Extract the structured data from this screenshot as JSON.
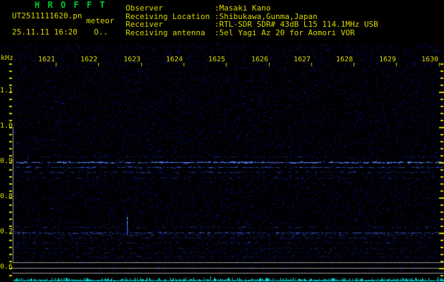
{
  "header": {
    "title": "H R O F F T",
    "filename": "UT2511111620.pn",
    "observation_label": "meteor",
    "datetime": "25.11.11 16:20",
    "counter": "O..",
    "info": [
      {
        "label": "Observer",
        "value": ":Masaki Kano"
      },
      {
        "label": "Receiving Location",
        "value": ":Shibukawa,Gunma,Japan"
      },
      {
        "label": "Receiver",
        "value": ":RTL-SDR SDR# 43dB L15 114.1MHz USB"
      },
      {
        "label": "Receiving antenna",
        "value": ":5el Yagi Az 20 for Aomori VOR"
      }
    ]
  },
  "spectrogram": {
    "unit_label": "kHz",
    "freq_ticks": [
      "1.1",
      "1.0",
      "0.9",
      "0.8",
      "0.7",
      "0.6"
    ],
    "time_ticks": [
      "1621",
      "1622",
      "1623",
      "1624",
      "1625",
      "1626",
      "1627",
      "1628",
      "1629",
      "1630"
    ]
  },
  "colors": {
    "background": "#000000",
    "text_yellow": "#d8d800",
    "title_green": "#00cc33",
    "grid_gray": "#9a9a9a",
    "signal_cyan": "#00d2d2",
    "noise_blue": "#2020c8"
  }
}
